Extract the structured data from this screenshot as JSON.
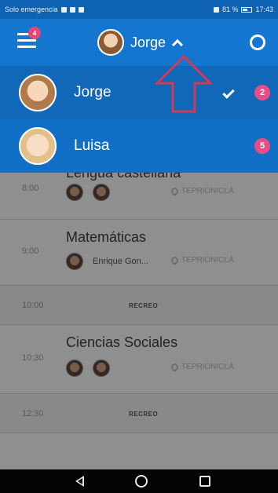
{
  "status_bar": {
    "carrier": "Solo emergencia",
    "time": "17:43",
    "battery": "81 %"
  },
  "app_bar": {
    "menu_badge": "4",
    "selected_child": "Jorge"
  },
  "children_menu": [
    {
      "name": "Jorge",
      "badge": "2",
      "selected": true
    },
    {
      "name": "Luisa",
      "badge": "5",
      "selected": false
    }
  ],
  "schedule": {
    "slots": [
      {
        "time": "8:00",
        "subject": "Lengua castellana",
        "teacher": "",
        "room": "TEPRIONICLA"
      },
      {
        "time": "9:00",
        "subject": "Matemáticas",
        "teacher": "Enrique Gon...",
        "room": "TEPRIONICLA"
      },
      {
        "time": "10:00",
        "break_label": "RECREO"
      },
      {
        "time": "10:30",
        "subject": "Ciencias Sociales",
        "teacher": "",
        "room": "TEPRIONICLA"
      },
      {
        "time": "12:30",
        "break_label": "RECREO"
      }
    ]
  },
  "colors": {
    "app_bar": "#1576d0",
    "dropdown": "#1168b9",
    "badge": "#ea4d83",
    "annotation_arrow": "#d23a55"
  },
  "icons": [
    "menu-icon",
    "gear-icon",
    "chevron-up-icon",
    "check-icon",
    "pin-icon",
    "back-icon",
    "home-icon",
    "recents-icon"
  ]
}
